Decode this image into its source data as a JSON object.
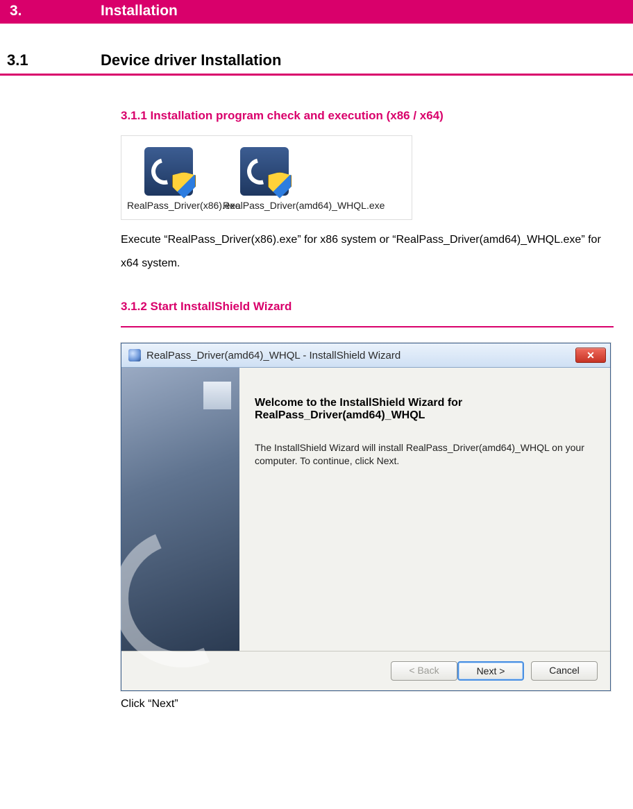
{
  "h1": {
    "num": "3.",
    "title": "Installation"
  },
  "h2": {
    "num": "3.1",
    "title": "Device driver Installation"
  },
  "sec311": {
    "heading": "3.1.1 Installation program check and execution (x86 / x64)",
    "iconLabels": [
      "RealPass_Driver(x86).exe",
      "RealPass_Driver(amd64)_WHQL.exe"
    ],
    "text": "Execute “RealPass_Driver(x86).exe” for x86 system or “RealPass_Driver(amd64)_WHQL.exe” for x64 system."
  },
  "sec312": {
    "heading": "3.1.2 Start InstallShield Wizard",
    "wizard": {
      "windowTitle": "RealPass_Driver(amd64)_WHQL - InstallShield Wizard",
      "closeGlyph": "✕",
      "welcomeTitle": "Welcome to the InstallShield Wizard for RealPass_Driver(amd64)_WHQL",
      "welcomeBody": "The InstallShield Wizard will install RealPass_Driver(amd64)_WHQL on your computer.  To continue, click Next.",
      "buttons": {
        "back": "< Back",
        "next": "Next >",
        "cancel": "Cancel"
      }
    },
    "caption": "Click “Next”"
  }
}
